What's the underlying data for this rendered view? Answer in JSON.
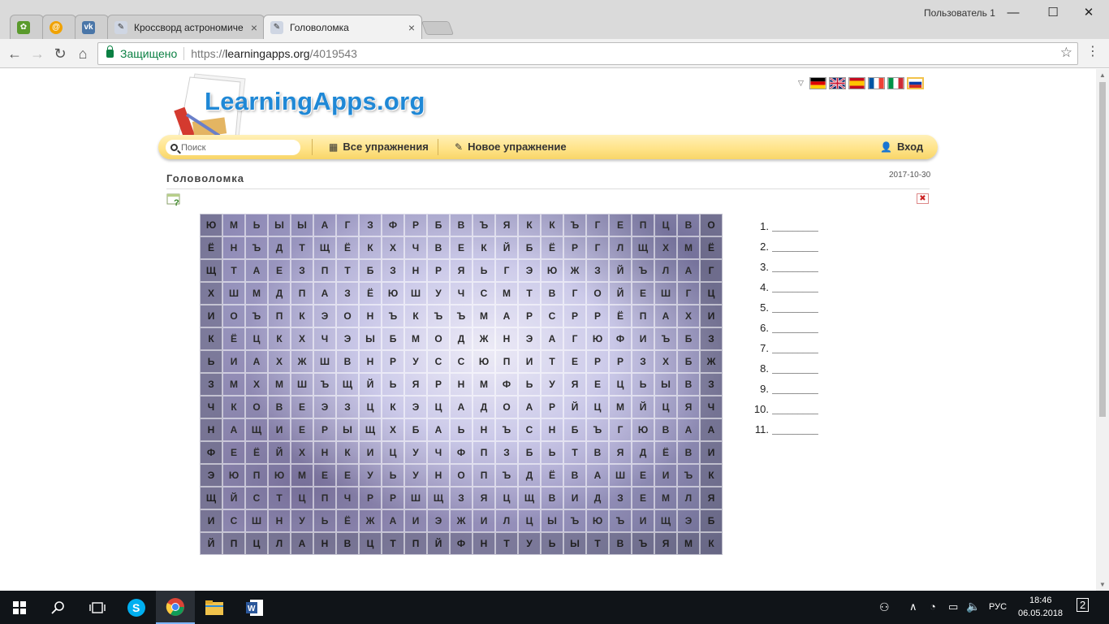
{
  "browser": {
    "tabs": [
      {
        "title": "",
        "icon": "app-green-icon"
      },
      {
        "title": "",
        "icon": "at-sign-icon"
      },
      {
        "title": "",
        "icon": "vk-icon"
      },
      {
        "title": "Кроссворд астрономиче",
        "icon": "learningapps-icon",
        "close": "×"
      },
      {
        "title": "Головоломка",
        "icon": "learningapps-icon",
        "close": "×",
        "active": true
      }
    ],
    "user_label": "Пользователь 1",
    "window_controls": {
      "minimize": "—",
      "maximize": "☐",
      "close": "✕"
    },
    "nav": {
      "back": "←",
      "forward": "→",
      "reload": "↻",
      "home": "⌂"
    },
    "secure_label": "Защищено",
    "url_prefix": "https://",
    "url_host": "learningapps.org",
    "url_path": "/4019543",
    "star": "☆",
    "menu": "⋮"
  },
  "site": {
    "logo": "LearningApps.org",
    "languages": [
      "German",
      "English",
      "Spanish",
      "French",
      "Italian",
      "Russian"
    ],
    "selected_language": "Russian",
    "search_placeholder": "Поиск",
    "nav_all": "Все упражнения",
    "nav_new": "Новое упражнение",
    "nav_login": "Вход",
    "exercise_title": "Головоломка",
    "exercise_date": "2017-10-30",
    "fullscreen": "✖"
  },
  "grid_rows": [
    "ЮМЬЫЫАГЗФРБВЪЯККЪГЕПЦВО",
    "ЁНЪДТЩЁКХЧВЕКЙБЁРГЛЩХМЁ",
    "ЩТАЕЗПТБЗНРЯЬГЭЮЖЗЙЪЛАГ",
    "ХШМДПАЗЁЮШУЧСМТВГОЙЕШГЦ",
    "ИОЪПКЭОНЪКЪЪМАРСРРЁПАХИ",
    "КЁЦКХЧЭЫБМОДЖНЭАГЮФИЪБЗ",
    "ЬИАХЖШВНРУССЮПИТЕРРЗХБЖ",
    "ЗМХМШЪЩЙЬЯРНМФЬУЯЕЦЬЫВЗ",
    "ЧКОВЕЭЗЦКЭЦАДОАРЙЦМЙЦЯЧ",
    "НАЩИЕРЫЩХБАЬНЪСНБЪГЮВАА",
    "ФЕЁЙХНКИЦУЧФПЗБЬТВЯДЁВИ",
    "ЭЮПЮМЕЕУЬУНОПЪДЁВАШЕИЪК",
    "ЩЙСТЦПЧРРШЩЗЯЦЩВИДЗЕМЛЯ",
    "ИСШНУЬЁЖАИЭЖИЛЦЫЪЮЪИЩЭБ",
    "ЙПЦЛАНВЦТПЙФНТУЬЫТВЪЯМК"
  ],
  "answers": [
    {
      "num": "1.",
      "line": "_________"
    },
    {
      "num": "2.",
      "line": "_________"
    },
    {
      "num": "3.",
      "line": "_________"
    },
    {
      "num": "4.",
      "line": "_________"
    },
    {
      "num": "5.",
      "line": "_________"
    },
    {
      "num": "6.",
      "line": "_________"
    },
    {
      "num": "7.",
      "line": "_________"
    },
    {
      "num": "8.",
      "line": "_________"
    },
    {
      "num": "9.",
      "line": "_________"
    },
    {
      "num": "10.",
      "line": "_________"
    },
    {
      "num": "11.",
      "line": "_________"
    }
  ],
  "taskbar": {
    "apps": [
      "windows-start-icon",
      "search-icon",
      "task-view-icon",
      "skype-icon",
      "chrome-icon",
      "file-explorer-icon",
      "word-icon"
    ],
    "lang": "РУС",
    "time": "18:46",
    "date": "06.05.2018",
    "notifications": "2"
  }
}
